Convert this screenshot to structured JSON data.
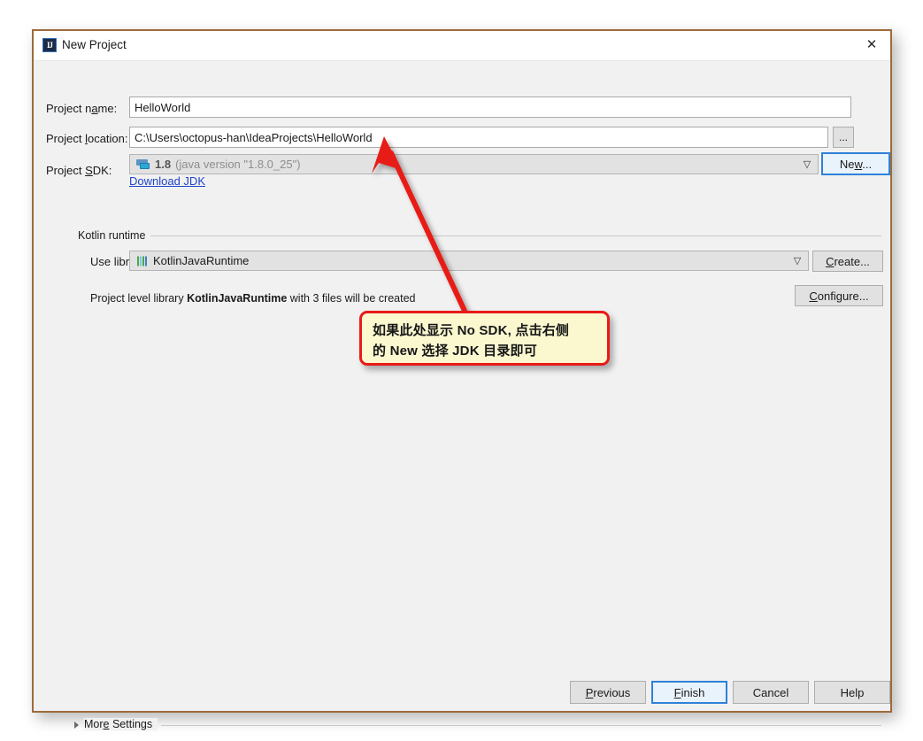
{
  "window": {
    "title": "New Project",
    "app_icon": "intellij-idea-icon",
    "close_icon": "close-icon",
    "border_color": "#9d6b3c",
    "background": "#f1f1f1"
  },
  "form": {
    "project_name": {
      "label_before": "Project n",
      "label_mnemonic": "a",
      "label_after": "me:",
      "value": "HelloWorld"
    },
    "project_location": {
      "label_before": "Project ",
      "label_mnemonic": "l",
      "label_after": "ocation:",
      "value": "C:\\Users\\octopus-han\\IdeaProjects\\HelloWorld",
      "browse_button_label": "..."
    },
    "project_sdk": {
      "label_before": "Project ",
      "label_mnemonic": "S",
      "label_after": "DK:",
      "value_bold": "1.8",
      "value_rest": "(java version \"1.8.0_25\")",
      "icon": "sdk-monitor-icon",
      "chevron": "chevron-down-icon",
      "new_button_before": "Ne",
      "new_button_mnemonic": "w",
      "new_button_after": "...",
      "download_link": "Download JDK"
    }
  },
  "kotlin_runtime": {
    "group_label": "Kotlin runtime",
    "use_library": {
      "label_before": "Use library:",
      "value": "KotlinJavaRuntime",
      "icon": "library-bars-icon",
      "chevron": "chevron-down-icon"
    },
    "create_button_before": "",
    "create_button_mnemonic": "C",
    "create_button_after": "reate...",
    "configure_button_mnemonic": "C",
    "configure_button_after": "onfigure...",
    "note_prefix": "Project level library ",
    "note_bold": "KotlinJavaRuntime",
    "note_suffix": " with 3 files will be created"
  },
  "more_settings": {
    "label_before": "Mor",
    "label_mnemonic": "e",
    "label_after": " Settings",
    "triangle_icon": "chevron-right-icon",
    "expanded": false
  },
  "footer": {
    "previous": {
      "before": "",
      "mnemonic": "P",
      "after": "revious"
    },
    "finish": {
      "before": "",
      "mnemonic": "F",
      "after": "inish",
      "is_default": true
    },
    "cancel": {
      "before": "Cancel",
      "mnemonic": "",
      "after": ""
    },
    "help": {
      "before": "Help",
      "mnemonic": "",
      "after": ""
    }
  },
  "annotation": {
    "line1": "如果此处显示 No SDK, 点击右侧",
    "line2": "的 New 选择 JDK 目录即可",
    "border_color": "#e81b18",
    "fill_color": "#fbf8d0",
    "arrow_color": "#e81b18",
    "arrow_points_to": "project-sdk-combo"
  }
}
